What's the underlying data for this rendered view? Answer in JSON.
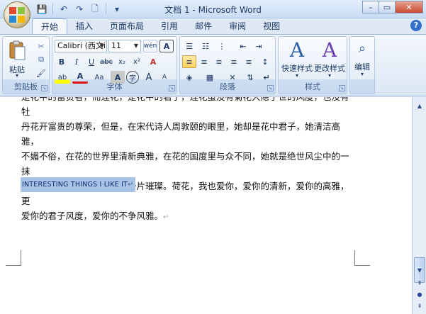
{
  "window": {
    "title": "文档 1 - Microsoft Word",
    "minimize": "–",
    "restore": "▭",
    "close": "✕"
  },
  "qat": {
    "save": "💾",
    "undo": "↶",
    "redo": "↷",
    "print_preview": "🗋",
    "customize": "▾"
  },
  "tabs": [
    "开始",
    "插入",
    "页面布局",
    "引用",
    "邮件",
    "审阅",
    "视图"
  ],
  "help": "?",
  "ribbon": {
    "clipboard": {
      "label": "剪贴板",
      "paste_label": "粘贴",
      "paste_arrow": "▾",
      "cut": "✂",
      "copy": "⧉",
      "format_painter": "🖌"
    },
    "font": {
      "label": "字体",
      "font_name": "Calibri (西文i",
      "font_size": "11",
      "bold": "B",
      "italic": "I",
      "underline": "U",
      "strike": "abc",
      "subscript": "x₂",
      "superscript": "x²",
      "clear_format": "A",
      "phonetic": "wén",
      "char_border": "A",
      "highlight": "ab",
      "font_color": "A",
      "change_case": "Aa",
      "char_shading": "A",
      "enclose": "字",
      "grow": "A",
      "shrink": "A"
    },
    "paragraph": {
      "label": "段落",
      "bullets": "☰",
      "numbering": "☷",
      "multilevel": "⋮",
      "decrease_indent": "⇤",
      "increase_indent": "⇥",
      "align_left": "≡",
      "align_center": "≡",
      "align_right": "≡",
      "justify": "≡",
      "distributed": "≡",
      "line_spacing": "↕",
      "shading": "◈",
      "borders": "▦",
      "chinese_layout": "✕",
      "sort": "⇅",
      "show_marks": "↵"
    },
    "styles": {
      "label": "样式",
      "quick_styles": "快速样式",
      "change_styles": "更改样式",
      "glyph": "A"
    },
    "editing": {
      "label": "编辑",
      "glyph": "⌕"
    }
  },
  "document": {
    "paragraph_lines": [
      "是花中的富贵者，而莲花，是花中的君子，莲花虽没有菊花大隐于世的风度，也没有牡",
      "丹花开富贵的尊荣，但是，在宋代诗人周敦颐的眼里，她却是花中君子，她清洁高雅，",
      "不媚不俗，在花的世界里清新典雅，在花的国度里与众不同，她就是绝世风尘中的一抹",
      "亮色，她就是滚滚红尘里的一片璀璨。荷花，我也爱你，爱你的清新，爱你的高雅，更",
      "爱你的君子风度，爱你的不争风雅。"
    ],
    "para_mark": "↵",
    "heading": "INTERESTING THINGS I LIKE IT"
  },
  "scrollbar": {
    "up": "▲",
    "down": "▼",
    "prev_page": "⇞",
    "browse": "●",
    "next_page": "⇟"
  }
}
